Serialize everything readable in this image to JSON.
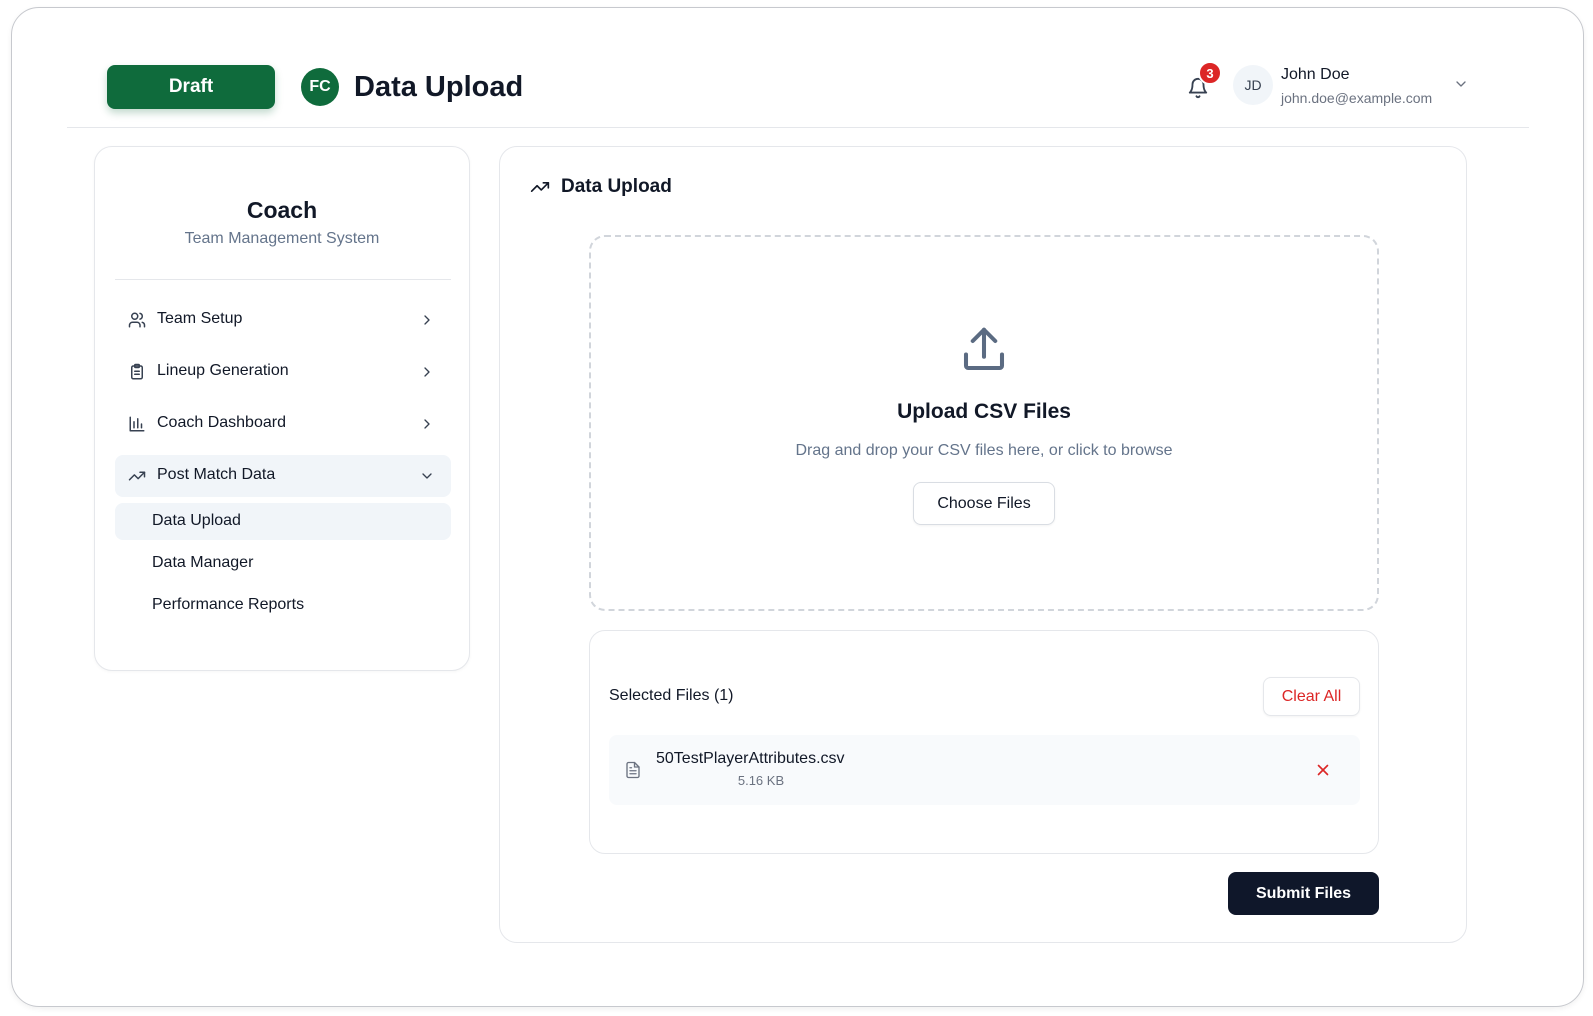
{
  "header": {
    "draft_label": "Draft",
    "logo_text": "FC",
    "title": "Data Upload",
    "notification_count": "3",
    "user": {
      "initials": "JD",
      "name": "John Doe",
      "email": "john.doe@example.com"
    }
  },
  "sidebar": {
    "title": "Coach",
    "subtitle": "Team Management System",
    "items": [
      {
        "label": "Team Setup",
        "icon": "users-icon",
        "expanded": false
      },
      {
        "label": "Lineup Generation",
        "icon": "clipboard-icon",
        "expanded": false
      },
      {
        "label": "Coach Dashboard",
        "icon": "bar-chart-icon",
        "expanded": false
      },
      {
        "label": "Post Match Data",
        "icon": "trending-up-icon",
        "expanded": true
      }
    ],
    "sub_items": [
      {
        "label": "Data Upload",
        "active": true
      },
      {
        "label": "Data Manager",
        "active": false
      },
      {
        "label": "Performance Reports",
        "active": false
      }
    ]
  },
  "main": {
    "title": "Data Upload",
    "dropzone": {
      "title": "Upload CSV Files",
      "description": "Drag and drop your CSV files here, or click to browse",
      "button_label": "Choose Files"
    },
    "selected_files": {
      "title": "Selected Files (1)",
      "clear_label": "Clear All",
      "files": [
        {
          "name": "50TestPlayerAttributes.csv",
          "size": "5.16 KB"
        }
      ]
    },
    "submit_label": "Submit Files"
  },
  "colors": {
    "brand_green": "#0f6b3c",
    "danger": "#dc2626",
    "dark_button": "#0f172a",
    "muted_text": "#64748b"
  }
}
